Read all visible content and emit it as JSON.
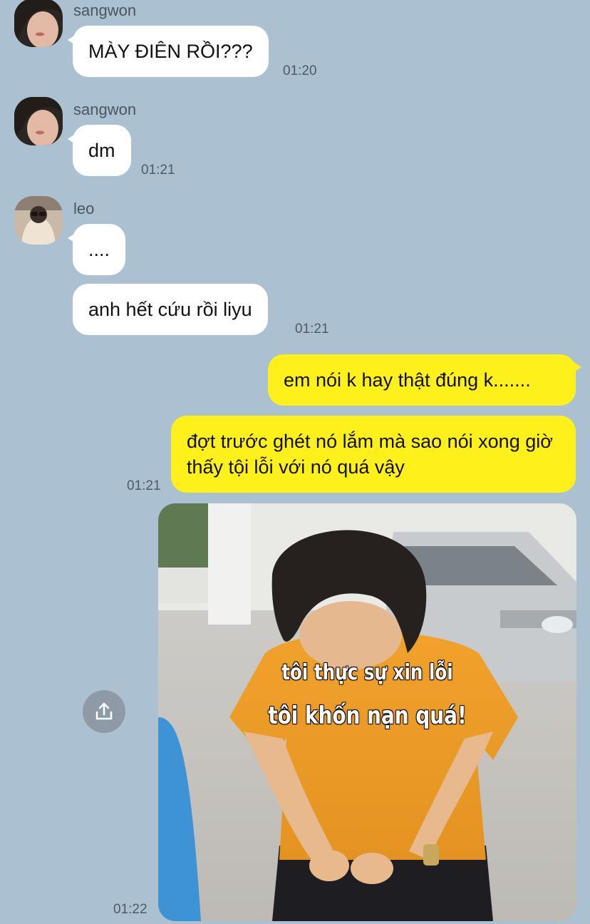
{
  "messages": [
    {
      "sender": "sangwon",
      "text": "MÀY ĐIÊN RỒI???",
      "time": "01:20"
    },
    {
      "sender": "sangwon",
      "text": "dm",
      "time": "01:21"
    },
    {
      "sender": "leo",
      "texts": [
        "....",
        "anh hết cứu rồi liyu"
      ],
      "time": "01:21"
    }
  ],
  "outgoing": [
    {
      "text": "em nói k hay thật đúng k......."
    },
    {
      "text": "đợt trước ghét nó lắm mà sao nói xong giờ thấy tội lỗi với nó quá vậy",
      "time": "01:21"
    }
  ],
  "image_message": {
    "caption_line1": "tôi thực sự xin lỗi",
    "caption_line2": "tôi khốn nạn quá!",
    "time": "01:22"
  },
  "icons": {
    "share": "share-upload-icon"
  },
  "colors": {
    "background": "#abc1d1",
    "incoming_bubble": "#ffffff",
    "outgoing_bubble": "#fef01b"
  }
}
